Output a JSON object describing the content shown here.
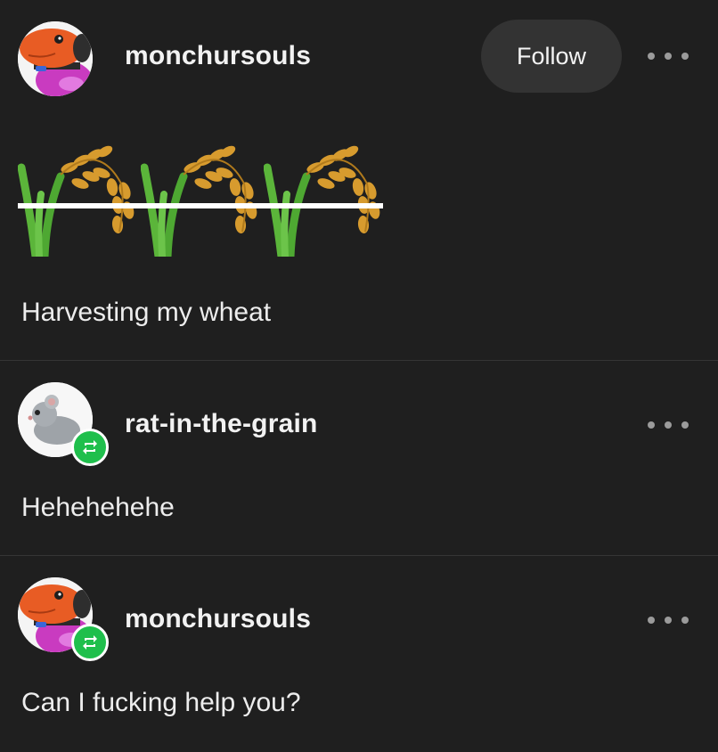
{
  "posts": [
    {
      "username": "monchursouls",
      "follow_label": "Follow",
      "image": {
        "emoji": [
          "wheat",
          "wheat",
          "wheat"
        ],
        "strikethrough": true
      },
      "text": "Harvesting my wheat"
    },
    {
      "username": "rat-in-the-grain",
      "reblog": true,
      "text": "Hehehehehe"
    },
    {
      "username": "monchursouls",
      "reblog": true,
      "text": "Can I fucking help you?"
    }
  ],
  "icons": {
    "more": "more-options-icon",
    "reblog": "reblog-icon",
    "wheat": "wheat-icon"
  },
  "colors": {
    "background": "#1f1f1f",
    "divider": "#353535",
    "follow_button": "#333333",
    "reblog_badge": "#1fbf4c"
  }
}
